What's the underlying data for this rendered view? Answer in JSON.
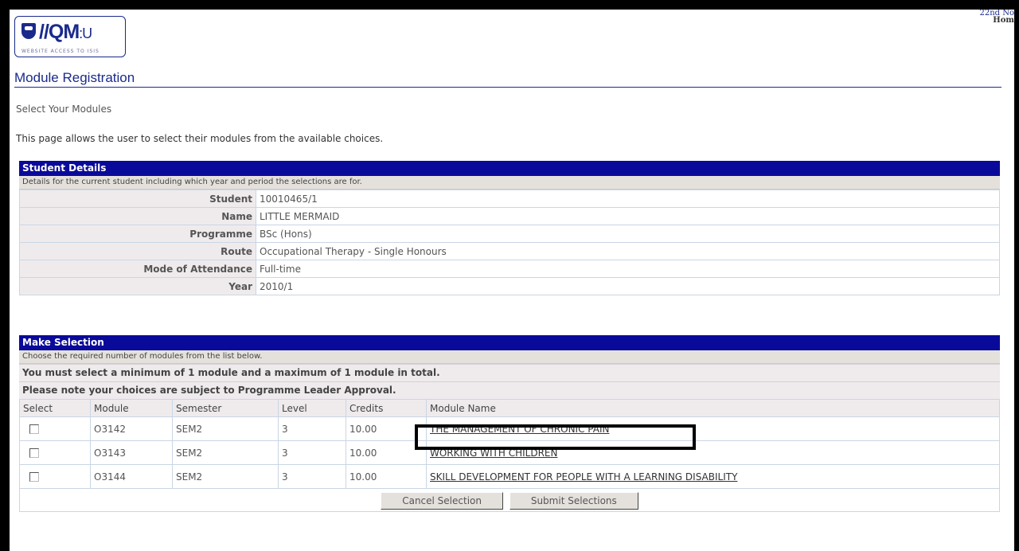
{
  "header": {
    "logo_text": "//QM",
    "logo_suffix": ":U",
    "logo_tagline": "WEBSITE ACCESS TO ISIS",
    "date_partial": "22nd No",
    "home_partial": "Hom"
  },
  "page": {
    "title": "Module Registration",
    "subtitle": "Select Your Modules",
    "intro": "This page allows the user to select their modules from the available choices."
  },
  "student_details": {
    "heading": "Student Details",
    "description": "Details for the current student including which year and period the selections are for.",
    "rows": [
      {
        "label": "Student",
        "value": "10010465/1"
      },
      {
        "label": "Name",
        "value": "LITTLE MERMAID"
      },
      {
        "label": "Programme",
        "value": "BSc (Hons)"
      },
      {
        "label": "Route",
        "value": "Occupational Therapy - Single Honours"
      },
      {
        "label": "Mode of Attendance",
        "value": "Full-time"
      },
      {
        "label": "Year",
        "value": "2010/1"
      }
    ]
  },
  "selection": {
    "heading": "Make Selection",
    "description": "Choose the required number of modules from the list below.",
    "note1": "You must select a minimum of 1 module and a maximum of 1 module in total.",
    "note2": "Please note your choices are subject to Programme Leader Approval.",
    "columns": [
      "Select",
      "Module",
      "Semester",
      "Level",
      "Credits",
      "Module Name"
    ],
    "modules": [
      {
        "code": "O3142",
        "semester": "SEM2",
        "level": "3",
        "credits": "10.00",
        "name": "THE MANAGEMENT OF CHRONIC PAIN",
        "selected": false
      },
      {
        "code": "O3143",
        "semester": "SEM2",
        "level": "3",
        "credits": "10.00",
        "name": "WORKING WITH CHILDREN",
        "selected": false
      },
      {
        "code": "O3144",
        "semester": "SEM2",
        "level": "3",
        "credits": "10.00",
        "name": "SKILL DEVELOPMENT FOR PEOPLE WITH A LEARNING DISABILITY",
        "selected": false
      }
    ],
    "cancel_label": "Cancel Selection",
    "submit_label": "Submit Selections"
  },
  "colors": {
    "panel_header": "#0a0a9a",
    "title": "#1a2a8c"
  }
}
